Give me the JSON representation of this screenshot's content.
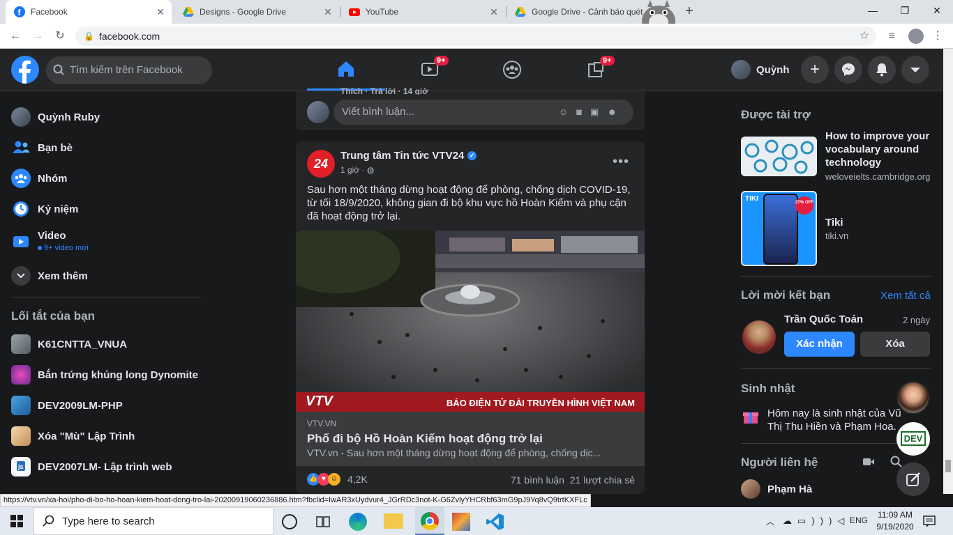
{
  "browser": {
    "tabs": [
      {
        "title": "Facebook",
        "icon": "facebook-favicon"
      },
      {
        "title": "Designs - Google Drive",
        "icon": "drive-favicon"
      },
      {
        "title": "YouTube",
        "icon": "youtube-favicon"
      },
      {
        "title": "Google Drive - Cảnh báo quét",
        "icon": "drive-favicon"
      }
    ],
    "url": "facebook.com",
    "status_url": "https://vtv.vn/xa-hoi/pho-di-bo-ho-hoan-kiem-hoat-dong-tro-lai-20200919060236886.htm?fbclid=IwAR3xUydvur4_JGrRDc3not-K-G6ZvlyYHCRbf63mG9pJ9Yq8vQ9trtKXFLc"
  },
  "header": {
    "search_placeholder": "Tìm kiếm trên Facebook",
    "watch_badge": "9+",
    "gaming_badge": "9+",
    "user_name": "Quỳnh"
  },
  "left": {
    "items": [
      {
        "label": "Quỳnh Ruby",
        "icon": "avatar"
      },
      {
        "label": "Bạn bè",
        "icon": "friends-icon"
      },
      {
        "label": "Nhóm",
        "icon": "groups-icon"
      },
      {
        "label": "Kỷ niệm",
        "icon": "memories-icon"
      },
      {
        "label": "Video",
        "icon": "video-icon",
        "sub": "9+ video mới"
      },
      {
        "label": "Xem thêm",
        "icon": "chevron-down-icon"
      }
    ],
    "shortcuts_title": "Lối tắt của bạn",
    "shortcuts": [
      {
        "label": "K61CNTTA_VNUA"
      },
      {
        "label": "Bắn trứng khủng long Dynomite"
      },
      {
        "label": "DEV2009LM-PHP"
      },
      {
        "label": "Xóa \"Mù\" Lập Trình"
      },
      {
        "label": "DEV2007LM- Lập trình web"
      }
    ]
  },
  "feed": {
    "prev_comment_meta": "Thích · Trả lời · 14 giờ",
    "comment_placeholder": "Viết bình luận...",
    "post": {
      "page_name": "Trung tâm Tin tức VTV24",
      "avatar_text": "24",
      "time": "1 giờ · ",
      "text": "Sau hơn một tháng dừng hoạt động để phòng, chống dịch COVID-19, từ tối 18/9/2020, không gian đi bộ khu vực hồ Hoàn Kiếm và phụ cận đã hoạt động trở lại.",
      "image_banner": "BÁO ĐIỆN TỬ ĐÀI TRUYỀN HÌNH VIỆT NAM",
      "image_logo": "VTV",
      "link_domain": "VTV.VN",
      "link_title": "Phố đi bộ Hồ Hoàn Kiếm hoạt động trở lại",
      "link_desc": "VTV.vn - Sau hơn một tháng dừng hoạt động để phòng, chống dịc...",
      "reactions": "4,2K",
      "comments": "71 bình luận",
      "shares": "21 lượt chia sẻ"
    }
  },
  "right": {
    "sponsored_title": "Được tài trợ",
    "ads": [
      {
        "title": "How to improve your vocabulary around technology",
        "domain": "weloveielts.cambridge.org"
      },
      {
        "title": "Tiki",
        "domain": "tiki.vn",
        "img_text": "TIKI",
        "sale": "27% OFF"
      }
    ],
    "friend_requests_title": "Lời mời kết bạn",
    "see_all": "Xem tất cả",
    "request": {
      "name": "Trần Quốc Toản",
      "time": "2 ngày",
      "confirm": "Xác nhận",
      "delete": "Xóa"
    },
    "birthdays_title": "Sinh nhật",
    "birthday_text": "Hôm nay là sinh nhật của Vũ Thị Thu Hiền và Phạm Hoa.",
    "contacts_title": "Người liên hệ",
    "contacts": [
      {
        "name": "Phạm Hà"
      }
    ],
    "dev_badge": "DEV"
  },
  "taskbar": {
    "search_placeholder": "Type here to search",
    "lang": "ENG",
    "time": "11:09 AM",
    "date": "9/19/2020"
  },
  "colors": {
    "fb_blue": "#2d88ff",
    "bg": "#18191a",
    "card": "#242526",
    "badge": "#e41e3f"
  }
}
